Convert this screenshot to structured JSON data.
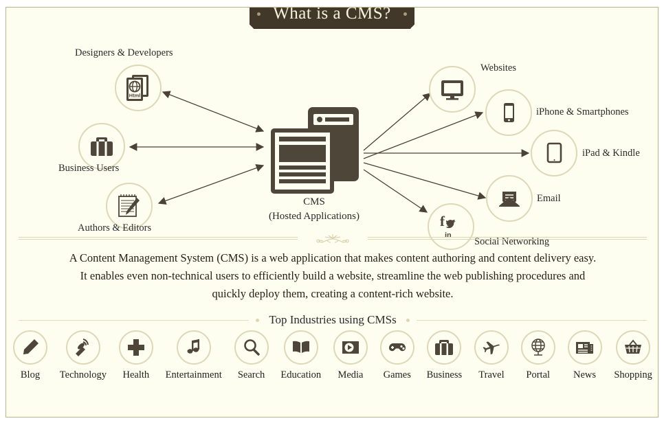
{
  "title": "What is a CMS?",
  "colors": {
    "background": "#fdfdf0",
    "panel_border": "#b7b58a",
    "banner_bg": "#423829",
    "banner_text": "#f7f2de",
    "icon": "#4f463a",
    "circle_border": "#ddd8b8",
    "arrow": "#4a4236",
    "rule": "#ddd6b3"
  },
  "diagram": {
    "center": {
      "label_line1": "CMS",
      "label_line2": "(Hosted Applications)",
      "icon": "cms-windows-icon"
    },
    "inputs": [
      {
        "label": "Designers & Developers",
        "icon": "html-document-icon",
        "arrow": "bidirectional"
      },
      {
        "label": "Business Users",
        "icon": "briefcase-icon",
        "arrow": "bidirectional"
      },
      {
        "label": "Authors & Editors",
        "icon": "notepad-pen-icon",
        "arrow": "bidirectional"
      }
    ],
    "outputs": [
      {
        "label": "Websites",
        "icon": "monitor-icon",
        "arrow": "outgoing"
      },
      {
        "label": "iPhone & Smartphones",
        "icon": "smartphone-icon",
        "arrow": "outgoing"
      },
      {
        "label": "iPad & Kindle",
        "icon": "tablet-icon",
        "arrow": "outgoing"
      },
      {
        "label": "Email",
        "icon": "envelope-icon",
        "arrow": "outgoing"
      },
      {
        "label": "Social Networking",
        "icon": "social-facebook-twitter-linkedin-icon",
        "arrow": "outgoing"
      }
    ]
  },
  "description": {
    "line1": "A Content Management System (CMS) is a web application that makes content authoring and content delivery easy.",
    "line2": "It enables even non-technical users to efficiently build a website, streamline the web publishing procedures and",
    "line3": "quickly deploy them, creating a content-rich website."
  },
  "industries": {
    "heading": "Top Industries using CMSs",
    "items": [
      {
        "name": "Blog",
        "icon": "pencil-icon"
      },
      {
        "name": "Technology",
        "icon": "satellite-dish-icon"
      },
      {
        "name": "Health",
        "icon": "medical-cross-icon"
      },
      {
        "name": "Entertainment",
        "icon": "music-note-icon"
      },
      {
        "name": "Search",
        "icon": "magnifier-icon"
      },
      {
        "name": "Education",
        "icon": "open-book-icon"
      },
      {
        "name": "Media",
        "icon": "play-button-icon"
      },
      {
        "name": "Games",
        "icon": "gamepad-icon"
      },
      {
        "name": "Business",
        "icon": "briefcase-icon"
      },
      {
        "name": "Travel",
        "icon": "airplane-icon"
      },
      {
        "name": "Portal",
        "icon": "globe-stand-icon"
      },
      {
        "name": "News",
        "icon": "newspaper-icon"
      },
      {
        "name": "Shopping",
        "icon": "shopping-basket-icon"
      }
    ]
  }
}
